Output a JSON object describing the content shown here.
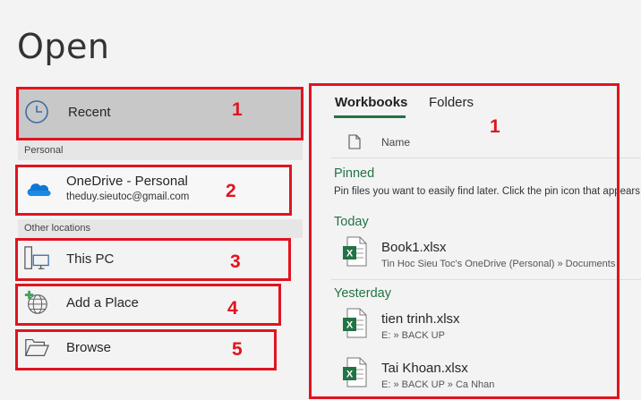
{
  "page": {
    "title": "Open"
  },
  "left": {
    "recent": {
      "label": "Recent",
      "marker": "1"
    },
    "section_personal": "Personal",
    "onedrive": {
      "label": "OneDrive - Personal",
      "email": "theduy.sieutoc@gmail.com",
      "marker": "2"
    },
    "section_other": "Other locations",
    "this_pc": {
      "label": "This PC",
      "marker": "3"
    },
    "add_place": {
      "label": "Add a Place",
      "marker": "4"
    },
    "browse": {
      "label": "Browse",
      "marker": "5"
    }
  },
  "right": {
    "marker": "1",
    "tabs": [
      {
        "label": "Workbooks",
        "active": true
      },
      {
        "label": "Folders",
        "active": false
      }
    ],
    "column_name": "Name",
    "pinned": {
      "title": "Pinned",
      "hint": "Pin files you want to easily find later. Click the pin icon that appears"
    },
    "today": {
      "title": "Today"
    },
    "yesterday": {
      "title": "Yesterday"
    },
    "files": [
      {
        "name": "Book1.xlsx",
        "path": "Tin Hoc Sieu Toc's OneDrive (Personal) » Documents"
      },
      {
        "name": "tien trinh.xlsx",
        "path": "E: » BACK UP"
      },
      {
        "name": "Tai Khoan.xlsx",
        "path": "E: » BACK UP » Ca Nhan"
      }
    ]
  },
  "colors": {
    "accent": "#217346",
    "annotation_red": "#e0141f",
    "selected_bg": "#c8c8c8"
  }
}
